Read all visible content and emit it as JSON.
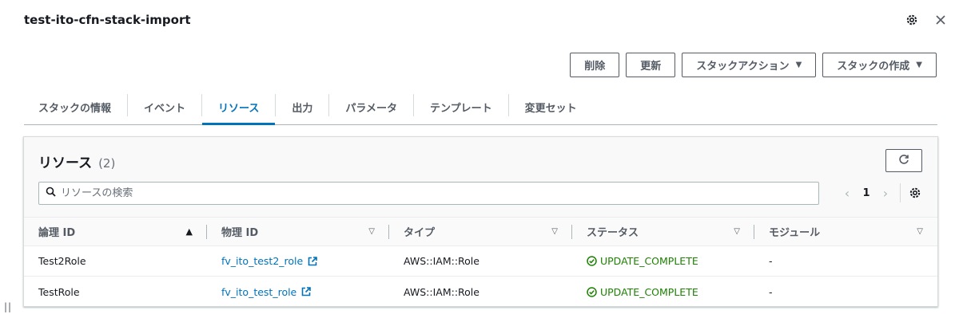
{
  "header": {
    "title": "test-ito-cfn-stack-import",
    "settings_icon": "gear-icon",
    "close_icon": "close-icon"
  },
  "actions": {
    "delete": "削除",
    "update": "更新",
    "stack_actions": "スタックアクション",
    "create_stack": "スタックの作成"
  },
  "tabs": [
    {
      "label": "スタックの情報"
    },
    {
      "label": "イベント"
    },
    {
      "label": "リソース",
      "active": true
    },
    {
      "label": "出力"
    },
    {
      "label": "パラメータ"
    },
    {
      "label": "テンプレート"
    },
    {
      "label": "変更セット"
    }
  ],
  "panel": {
    "title": "リソース",
    "count": "(2)",
    "search_placeholder": "リソースの検索",
    "page": "1"
  },
  "table": {
    "columns": [
      "論理 ID",
      "物理 ID",
      "タイプ",
      "ステータス",
      "モジュール"
    ],
    "rows": [
      {
        "logical_id": "Test2Role",
        "physical_id": "fv_ito_test2_role",
        "type": "AWS::IAM::Role",
        "status": "UPDATE_COMPLETE",
        "module": "-"
      },
      {
        "logical_id": "TestRole",
        "physical_id": "fv_ito_test_role",
        "type": "AWS::IAM::Role",
        "status": "UPDATE_COMPLETE",
        "module": "-"
      }
    ]
  },
  "colors": {
    "link": "#0073bb",
    "success": "#1d8102",
    "border": "#545b64"
  }
}
